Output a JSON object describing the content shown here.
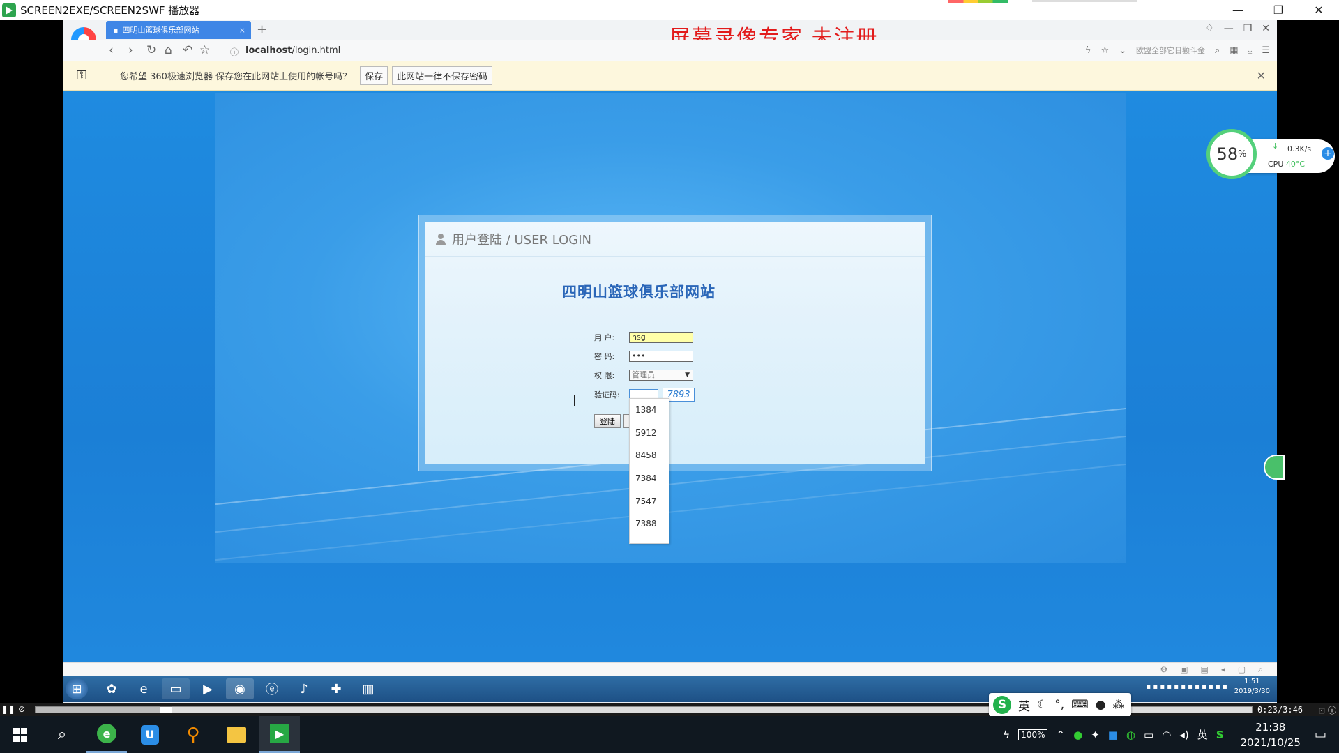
{
  "player": {
    "title": "SCREEN2EXE/SCREEN2SWF 播放器",
    "time": "0:23/3:46"
  },
  "browser": {
    "tab_title": "四明山篮球俱乐部网站",
    "url_host": "localhost",
    "url_path": "/login.html",
    "watermark": "屏幕录像专家  未注册",
    "ad_text": "欧盟全部它日颧斗金"
  },
  "password_bar": {
    "message": "您希望 360极速浏览器 保存您在此网站上使用的帐号吗？",
    "save_label": "保存",
    "never_label": "此网站一律不保存密码"
  },
  "login": {
    "header": "用户登陆 / USER LOGIN",
    "site_title": "四明山篮球俱乐部网站",
    "user_label": "用 户:",
    "user_value": "hsg",
    "pass_label": "密 码:",
    "pass_value": "•••",
    "role_label": "权 限:",
    "role_value": "管理员",
    "code_label": "验证码:",
    "code_value": "",
    "captcha": "7893",
    "login_button": "登陆",
    "autocomplete": [
      "1384",
      "5912",
      "8458",
      "7384",
      "7547",
      "7388"
    ]
  },
  "monitor": {
    "percent": "58",
    "percent_unit": "%",
    "net_speed": "0.3K/s",
    "cpu_label": "CPU",
    "cpu_temp": "40°C"
  },
  "win7": {
    "time": "1:51",
    "date": "2019/3/30"
  },
  "ime": {
    "mode": "英"
  },
  "taskbar": {
    "battery": "100%",
    "lang": "英",
    "time": "21:38",
    "date": "2021/10/25"
  },
  "colors": {
    "page_blue": "#1f8be0",
    "tab_blue": "#3f86e6",
    "watermark_red": "#e21b1b",
    "title_blue": "#2a66b8"
  }
}
